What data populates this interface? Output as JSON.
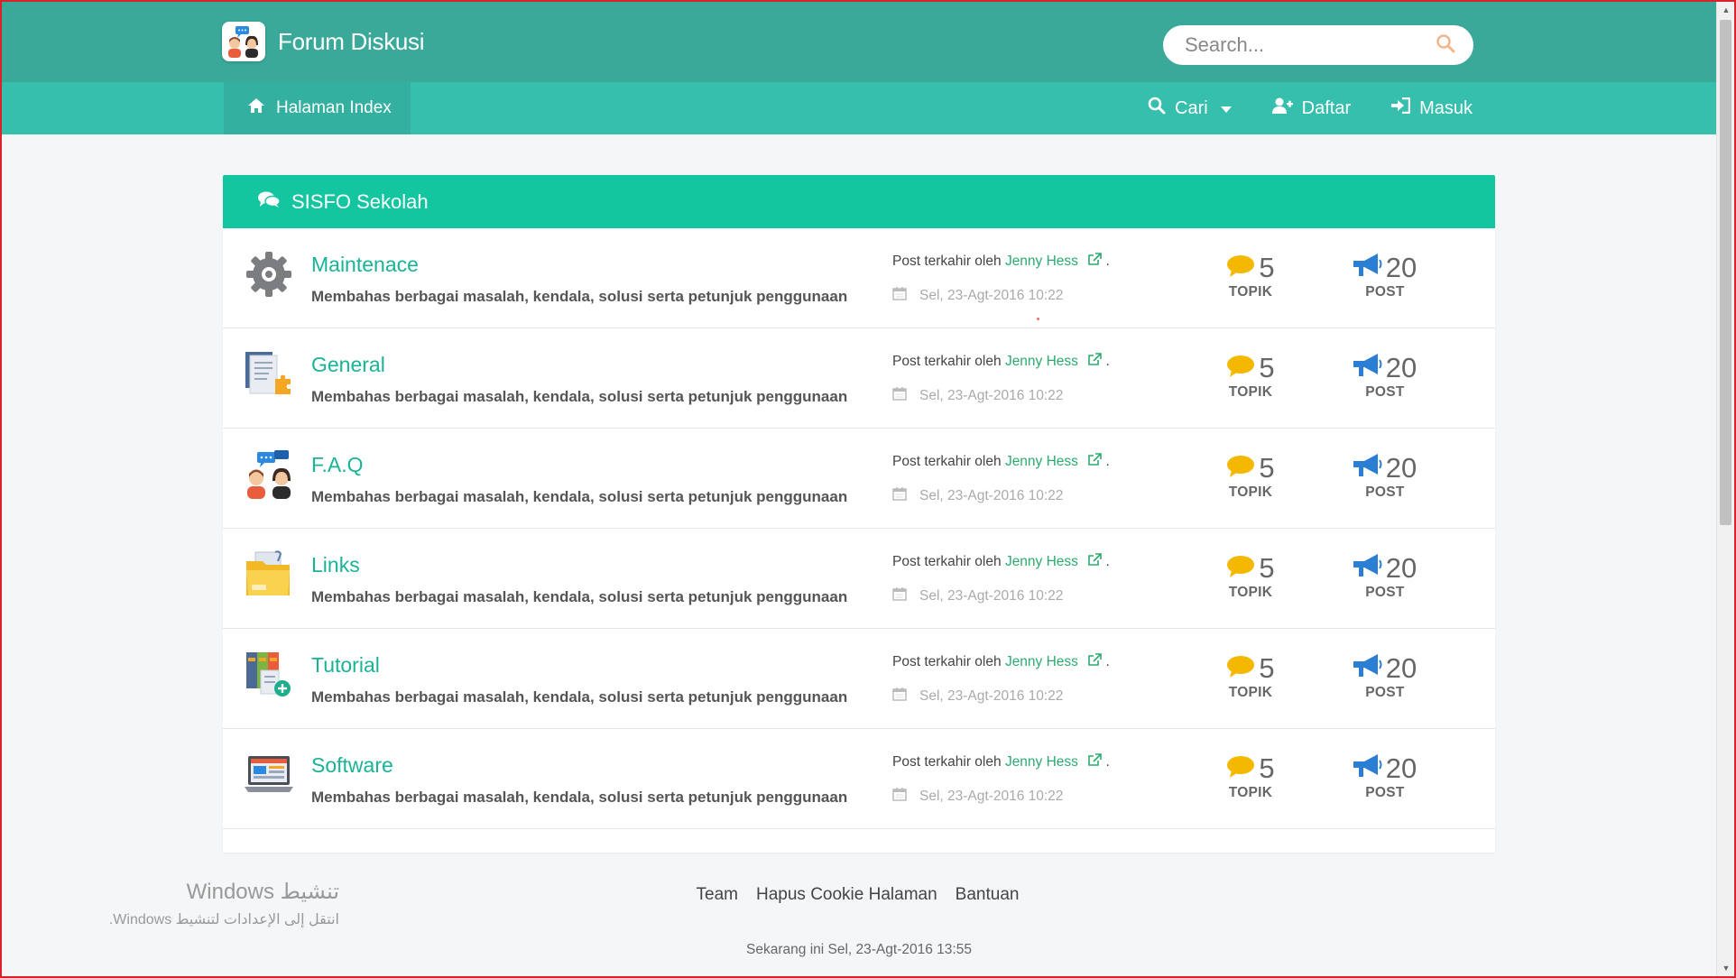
{
  "header": {
    "title": "Forum Diskusi",
    "search_placeholder": "Search..."
  },
  "nav": {
    "home": "Halaman Index",
    "search": "Cari",
    "register": "Daftar",
    "login": "Masuk"
  },
  "panel": {
    "title": "SISFO Sekolah"
  },
  "forums": [
    {
      "title": "Maintenace",
      "icon": "gear-icon",
      "description": "Membahas berbagai masalah, kendala, solusi serta petunjuk penggunaan",
      "last_post_prefix": "Post terkahir oleh",
      "author": "Jenny Hess",
      "suffix": ".",
      "date": "Sel, 23-Agt-2016 10:22",
      "topics": "5",
      "topics_label": "TOPIK",
      "posts": "20",
      "posts_label": "POST"
    },
    {
      "title": "General",
      "icon": "document-icon",
      "description": "Membahas berbagai masalah, kendala, solusi serta petunjuk penggunaan",
      "last_post_prefix": "Post terkahir oleh",
      "author": "Jenny Hess",
      "suffix": ".",
      "date": "Sel, 23-Agt-2016 10:22",
      "topics": "5",
      "topics_label": "TOPIK",
      "posts": "20",
      "posts_label": "POST"
    },
    {
      "title": "F.A.Q",
      "icon": "people-chat-icon",
      "description": "Membahas berbagai masalah, kendala, solusi serta petunjuk penggunaan",
      "last_post_prefix": "Post terkahir oleh",
      "author": "Jenny Hess",
      "suffix": ".",
      "date": "Sel, 23-Agt-2016 10:22",
      "topics": "5",
      "topics_label": "TOPIK",
      "posts": "20",
      "posts_label": "POST"
    },
    {
      "title": "Links",
      "icon": "folder-icon",
      "description": "Membahas berbagai masalah, kendala, solusi serta petunjuk penggunaan",
      "last_post_prefix": "Post terkahir oleh",
      "author": "Jenny Hess",
      "suffix": ".",
      "date": "Sel, 23-Agt-2016 10:22",
      "topics": "5",
      "topics_label": "TOPIK",
      "posts": "20",
      "posts_label": "POST"
    },
    {
      "title": "Tutorial",
      "icon": "books-icon",
      "description": "Membahas berbagai masalah, kendala, solusi serta petunjuk penggunaan",
      "last_post_prefix": "Post terkahir oleh",
      "author": "Jenny Hess",
      "suffix": ".",
      "date": "Sel, 23-Agt-2016 10:22",
      "topics": "5",
      "topics_label": "TOPIK",
      "posts": "20",
      "posts_label": "POST"
    },
    {
      "title": "Software",
      "icon": "laptop-icon",
      "description": "Membahas berbagai masalah, kendala, solusi serta petunjuk penggunaan",
      "last_post_prefix": "Post terkahir oleh",
      "author": "Jenny Hess",
      "suffix": ".",
      "date": "Sel, 23-Agt-2016 10:22",
      "topics": "5",
      "topics_label": "TOPIK",
      "posts": "20",
      "posts_label": "POST"
    }
  ],
  "footer": {
    "links": [
      "Team",
      "Hapus Cookie Halaman",
      "Bantuan"
    ],
    "time": "Sekarang ini Sel, 23-Agt-2016 13:55"
  },
  "watermark": {
    "title": "تنشيط Windows",
    "subtitle": "انتقل إلى الإعدادات لتنشيط Windows."
  },
  "colors": {
    "header": "#3ba99a",
    "navbar": "#37bfad",
    "panel_head": "#14c6a0",
    "link": "#19b396",
    "author": "#2bab6f",
    "topic_icon": "#f5b800",
    "post_icon": "#2a7fd4"
  }
}
